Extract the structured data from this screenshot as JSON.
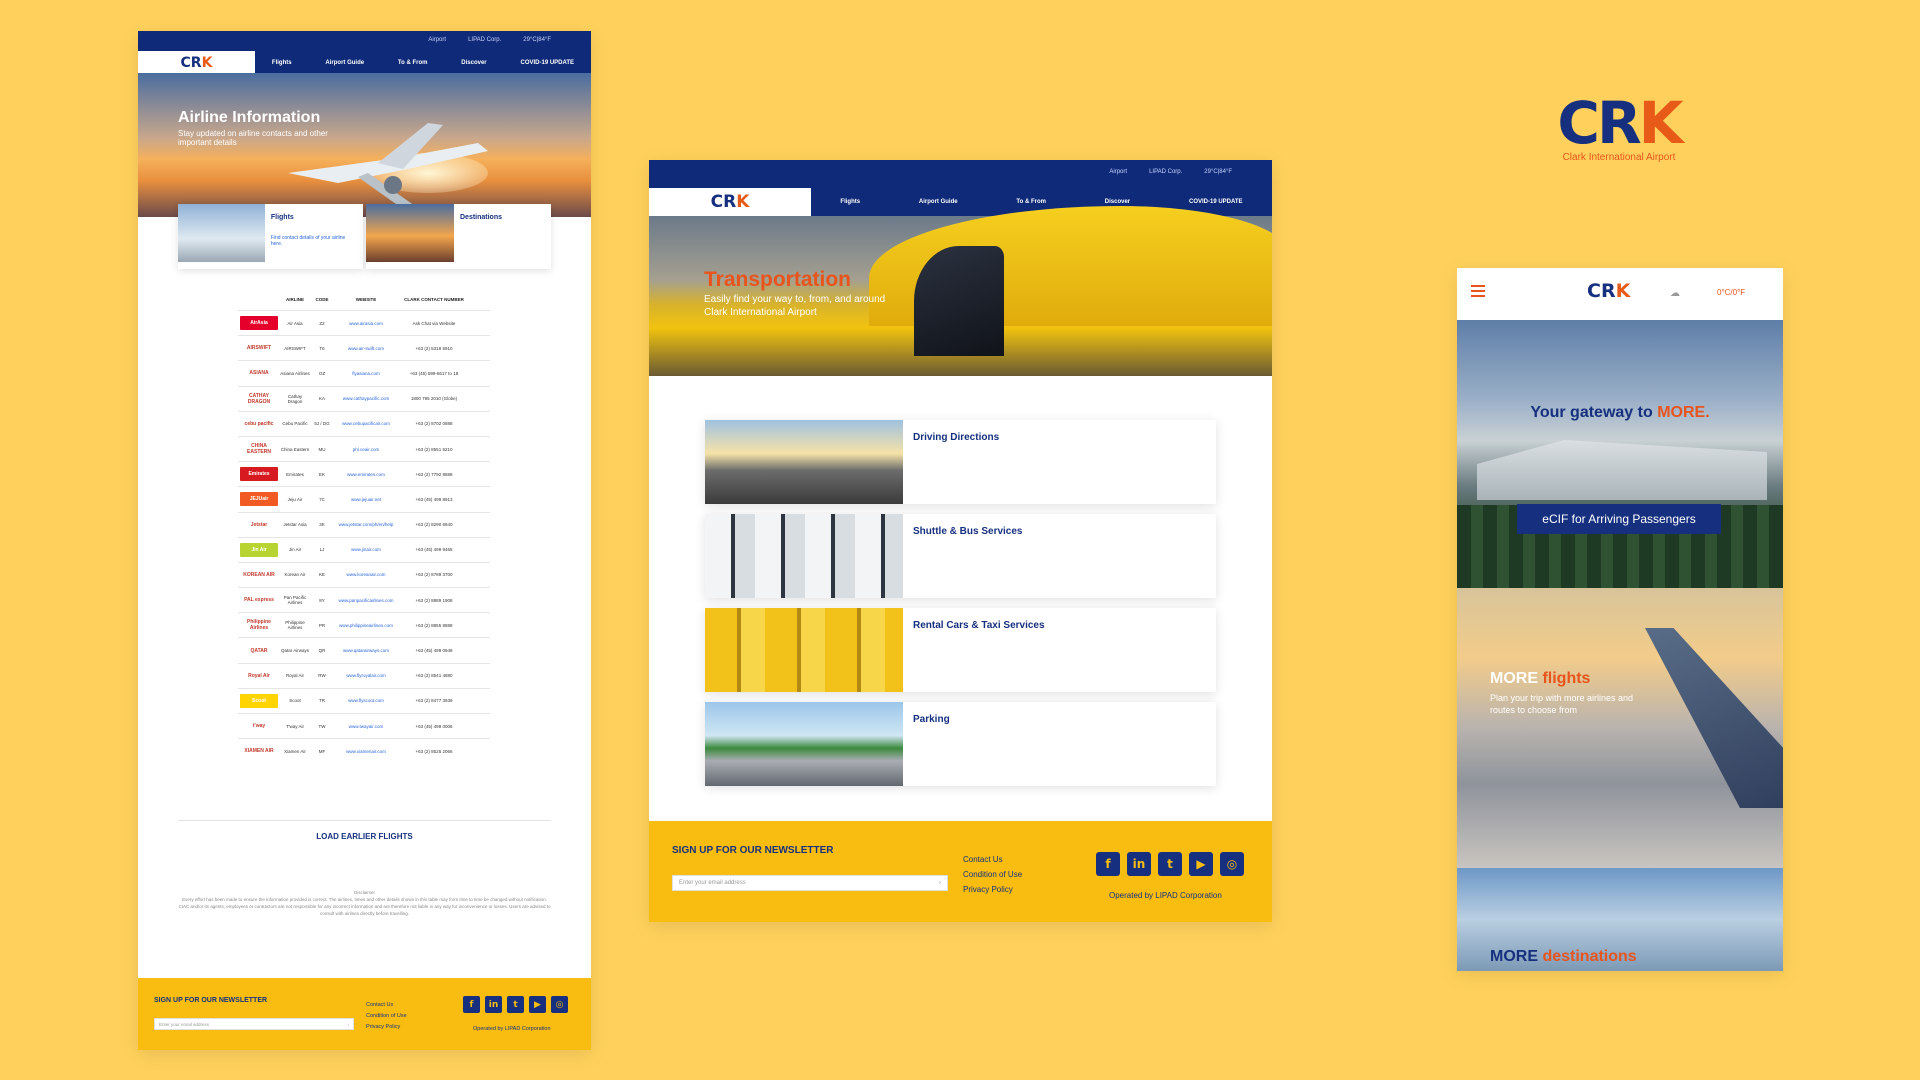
{
  "brand": {
    "mark_left": "CR",
    "mark_right": "K",
    "name": "Clark International Airport"
  },
  "header": {
    "util": [
      "Airport",
      "LIPAD Corp.",
      "29°C|84°F"
    ],
    "logo_left": "CR",
    "logo_right": "K",
    "nav": [
      "Flights",
      "Airport Guide",
      "To & From",
      "Discover",
      "COVID-19 UPDATE"
    ]
  },
  "airline_page": {
    "hero_title": "Airline Information",
    "hero_subtitle": "Stay updated on airline contacts and other important details",
    "cards": [
      {
        "title": "Flights",
        "desc": "Find contact details of your airline here."
      },
      {
        "title": "Destinations",
        "desc": ""
      }
    ],
    "table": {
      "headers": [
        "",
        "AIRLINE",
        "CODE",
        "WEBSITE",
        "CLARK CONTACT NUMBER"
      ],
      "rows": [
        {
          "logo": "AirAsia",
          "color": "#e4002b",
          "airline": "Air Asia",
          "code": "Z2",
          "web": "www.airasia.com",
          "phone": "Ask Chat via Website"
        },
        {
          "logo": "AIRSWIFT",
          "color": "#ffffff",
          "airline": "AIRSWIFT",
          "code": "T6",
          "web": "www.air-swift.com",
          "phone": "+63 (2) 5318 5910"
        },
        {
          "logo": "ASIANA",
          "color": "#ffffff",
          "airline": "Asiana Airlines",
          "code": "OZ",
          "web": "flyasiana.com",
          "phone": "+63 (45) 599-6617 to 18"
        },
        {
          "logo": "CATHAY DRAGON",
          "color": "#ffffff",
          "airline": "Cathay Dragon",
          "code": "KA",
          "web": "www.cathaypacific.com",
          "phone": "1800 795 2010 (Globe)"
        },
        {
          "logo": "cebu pacific",
          "color": "#ffffff",
          "airline": "Cebu Pacific",
          "code": "5J / DG",
          "web": "www.cebupacificair.com",
          "phone": "+63 (2) 8702 0888"
        },
        {
          "logo": "CHINA EASTERN",
          "color": "#ffffff",
          "airline": "China Eastern",
          "code": "MU",
          "web": "phl.ceair.com",
          "phone": "+63 (2) 8551 5210"
        },
        {
          "logo": "Emirates",
          "color": "#d71920",
          "airline": "Emirates",
          "code": "EK",
          "web": "www.emirates.com",
          "phone": "+63 (2) 7792 8888"
        },
        {
          "logo": "JEJUair",
          "color": "#f15a22",
          "airline": "Jeju Air",
          "code": "7C",
          "web": "www.jejuair.net",
          "phone": "+63 (45) 499 8913"
        },
        {
          "logo": "Jetstar",
          "color": "#ffffff",
          "airline": "Jetstar Asia",
          "code": "3K",
          "web": "www.jetstar.com/ph/en/help",
          "phone": "+63 (2) 8290 6940"
        },
        {
          "logo": "Jin Air",
          "color": "#b7d433",
          "airline": "Jin Air",
          "code": "LJ",
          "web": "www.jinair.com",
          "phone": "+63 (45) 499 9465"
        },
        {
          "logo": "KOREAN AIR",
          "color": "#ffffff",
          "airline": "Korean Air",
          "code": "KE",
          "web": "www.koreanair.com",
          "phone": "+63 (2) 8789 3700"
        },
        {
          "logo": "PAL express",
          "color": "#ffffff",
          "airline": "Pan Pacific Airlines",
          "code": "8Y",
          "web": "www.panpacificairlines.com",
          "phone": "+63 (2) 8889 1908"
        },
        {
          "logo": "Philippine Airlines",
          "color": "#ffffff",
          "airline": "Philippine Airlines",
          "code": "PR",
          "web": "www.philippineairlines.com",
          "phone": "+63 (2) 8855 8888"
        },
        {
          "logo": "QATAR",
          "color": "#ffffff",
          "airline": "Qatar Airways",
          "code": "QR",
          "web": "www.qatarairways.com",
          "phone": "+63 (45) 499 0948"
        },
        {
          "logo": "Royal Air",
          "color": "#ffffff",
          "airline": "Royal Air",
          "code": "RW",
          "web": "www.flyroyalair.com",
          "phone": "+63 (2) 8541 4880"
        },
        {
          "logo": "Scoot",
          "color": "#ffd400",
          "airline": "Scoot",
          "code": "TR",
          "web": "www.flyscoot.com",
          "phone": "+63 (2) 8477 3939"
        },
        {
          "logo": "t'way",
          "color": "#ffffff",
          "airline": "T'way Air",
          "code": "TW",
          "web": "www.twayair.com",
          "phone": "+63 (45) 499 0006"
        },
        {
          "logo": "XIAMEN AIR",
          "color": "#ffffff",
          "airline": "Xiamen Air",
          "code": "MF",
          "web": "www.xiamenair.com",
          "phone": "+63 (2) 8525 2066"
        }
      ]
    },
    "load_more": "LOAD EARLIER FLIGHTS",
    "disclaimer_title": "Disclaimer",
    "disclaimer": "Every effort has been made to ensure the information provided is correct. The airlines, times and other details shown in this table may from time to time be changed without notification. CIAC and/or its agents, employees or contractors are not responsible for any incorrect information and are therefore not liable in any way for inconvenience or losses. Users are advised to consult with airlines directly before travelling."
  },
  "transport_page": {
    "hero_title": "Transportation",
    "hero_subtitle": "Easily find your way to, from, and around Clark International Airport",
    "cards": [
      "Driving Directions",
      "Shuttle & Bus Services",
      "Rental Cars & Taxi Services",
      "Parking"
    ]
  },
  "footer": {
    "title": "SIGN UP FOR OUR NEWSLETTER",
    "email_placeholder": "Enter your email address",
    "links": [
      "Contact Us",
      "Condition of Use",
      "Privacy Policy"
    ],
    "social": [
      "facebook-icon",
      "linkedin-icon",
      "twitter-icon",
      "youtube-icon",
      "instagram-icon"
    ],
    "operator": "Operated by LIPAD Corporation"
  },
  "mobile": {
    "logo_left": "CR",
    "logo_right": "K",
    "temp": "0°C/0°F",
    "gateway_a": "Your gateway to ",
    "gateway_b": "MORE.",
    "ecif": "eCIF for Arriving Passengers",
    "flights_a": "MORE ",
    "flights_b": "flights",
    "flights_sub": "Plan your trip with more airlines and routes to choose from",
    "dest_a": "MORE ",
    "dest_b": "destinations"
  },
  "colors": {
    "navy": "#16307f",
    "orange": "#e8541c",
    "yellow": "#f9bd12",
    "bg": "#ffd15c"
  }
}
